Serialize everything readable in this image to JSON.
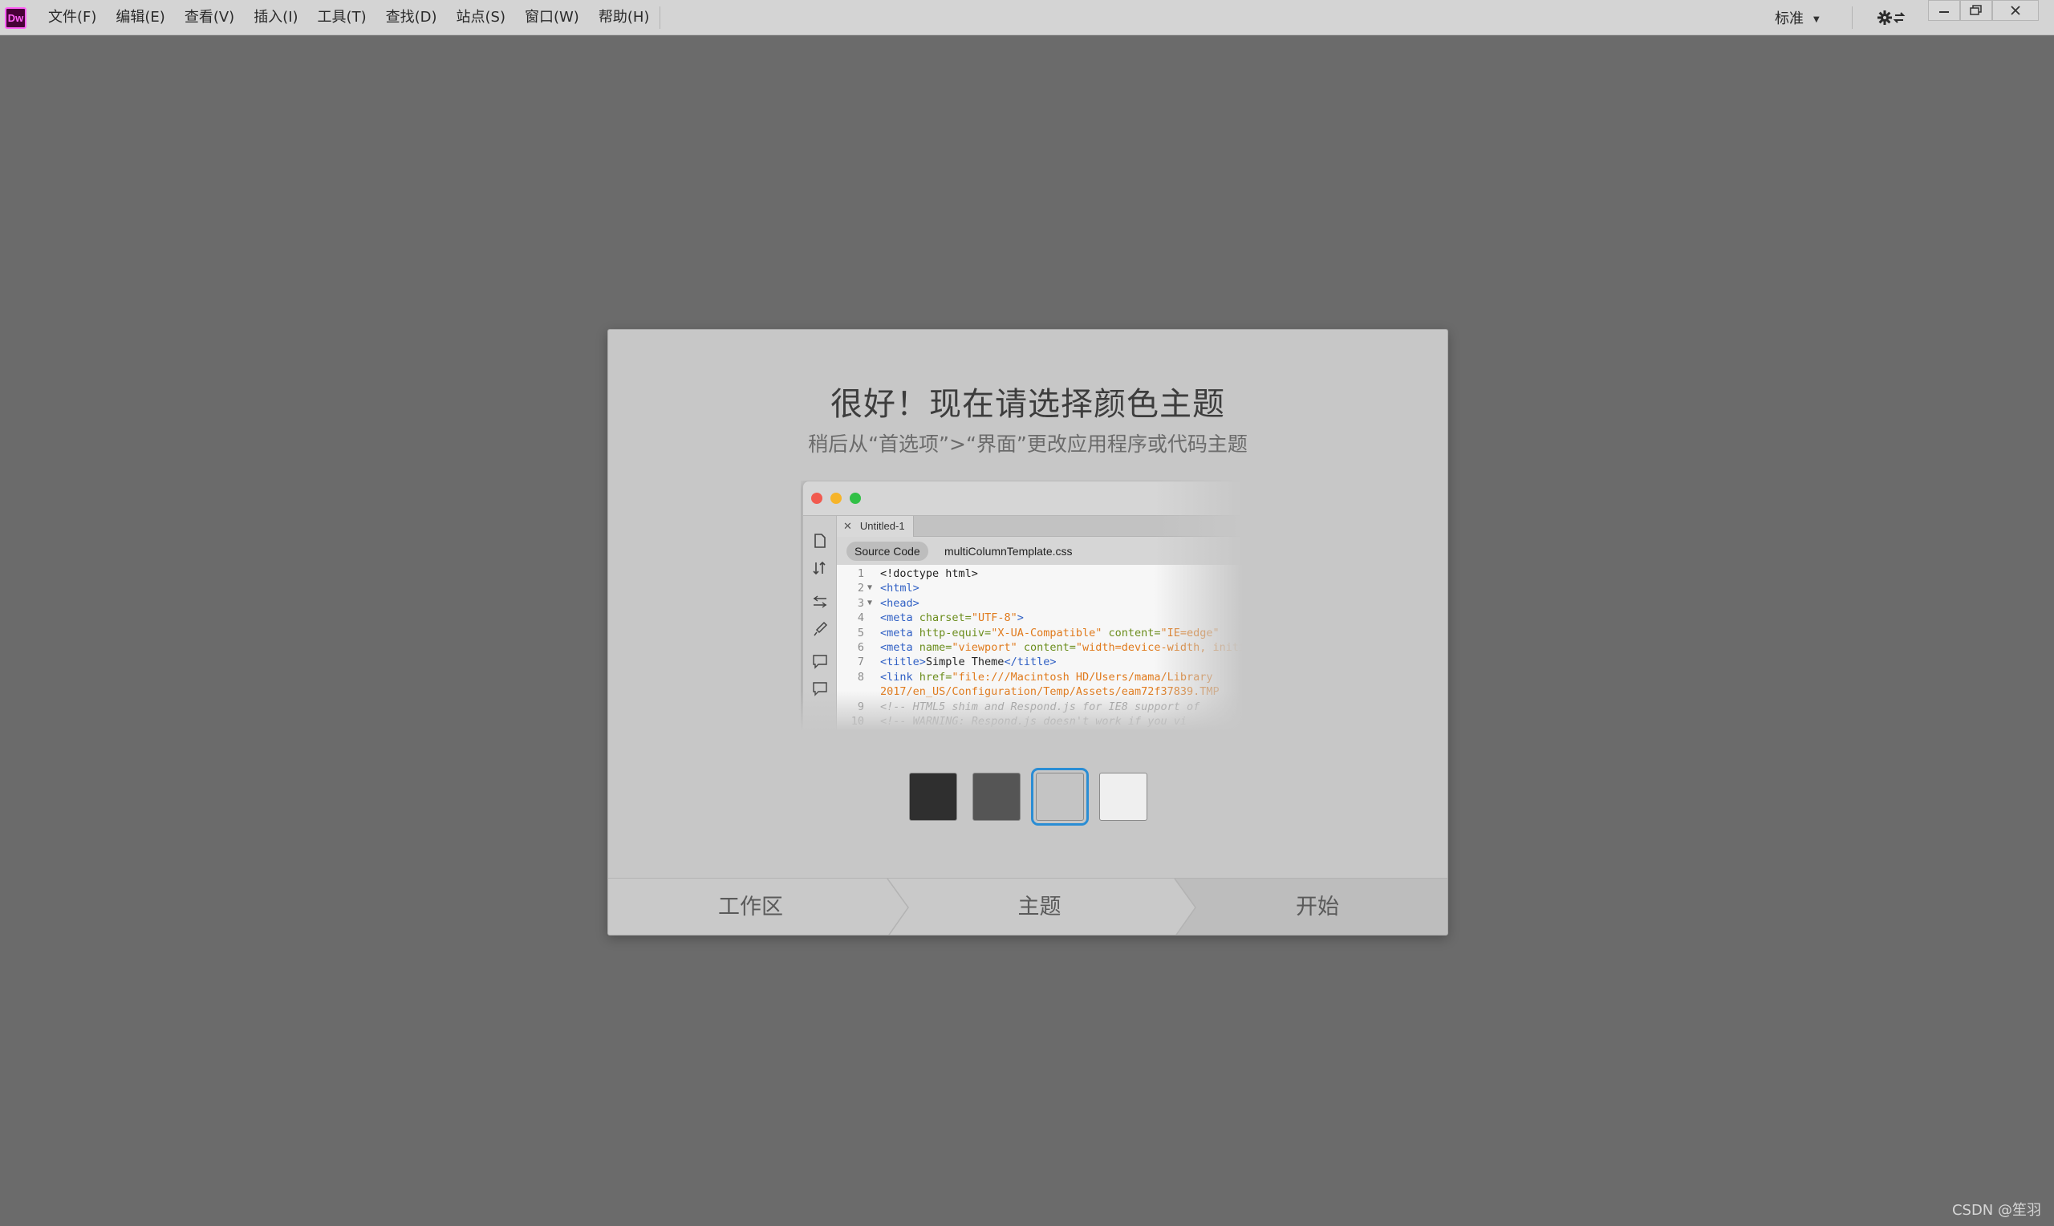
{
  "app": {
    "logo_text": "Dw",
    "logo_color": "#ff61f6",
    "logo_bg": "#470137"
  },
  "menu": {
    "items": [
      "文件(F)",
      "编辑(E)",
      "查看(V)",
      "插入(I)",
      "工具(T)",
      "查找(D)",
      "站点(S)",
      "窗口(W)",
      "帮助(H)"
    ]
  },
  "toolbar": {
    "workspace_label": "标准",
    "icons": [
      "chevron-down-icon",
      "gear-sync-icon",
      "minimize-icon",
      "restore-icon",
      "close-icon"
    ]
  },
  "dialog": {
    "title": "很好！现在请选择颜色主题",
    "subtitle": "稍后从“首选项”>“界面”更改应用程序或代码主题",
    "preview": {
      "tab_label": "Untitled-1",
      "active_doc": "Source Code",
      "other_doc": "multiColumnTemplate.css",
      "code_lines": [
        {
          "n": "1",
          "fold": "",
          "html": "<span class='txt'>&lt;!doctype html&gt;</span>"
        },
        {
          "n": "2",
          "fold": "▼",
          "html": "<span class='tg'>&lt;html&gt;</span>"
        },
        {
          "n": "3",
          "fold": "▼",
          "html": "<span class='tg'>&lt;head&gt;</span>"
        },
        {
          "n": "4",
          "fold": "",
          "html": "<span class='tg'>&lt;meta </span><span class='at'>charset=</span><span class='st'>\"UTF-8\"</span><span class='tg'>&gt;</span>"
        },
        {
          "n": "5",
          "fold": "",
          "html": "<span class='tg'>&lt;meta </span><span class='at'>http-equiv=</span><span class='st'>\"X-UA-Compatible\"</span><span class='at'> content=</span><span class='st'>\"IE=edge\"</span>"
        },
        {
          "n": "6",
          "fold": "",
          "html": "<span class='tg'>&lt;meta </span><span class='at'>name=</span><span class='st'>\"viewport\"</span><span class='at'> content=</span><span class='st'>\"width=device-width, initial</span>"
        },
        {
          "n": "7",
          "fold": "",
          "html": "<span class='tg'>&lt;title&gt;</span><span class='txt'>Simple Theme</span><span class='tg'>&lt;/title&gt;</span>"
        },
        {
          "n": "8",
          "fold": "",
          "html": "<span class='tg'>&lt;link </span><span class='at'>href=</span><span class='st'>\"file:///Macintosh HD/Users/mama/Library</span>"
        },
        {
          "n": "",
          "fold": "",
          "html": "<span class='st'>2017/en_US/Configuration/Temp/Assets/eam72f37839.TMP</span>"
        },
        {
          "n": "9",
          "fold": "",
          "html": "<span class='cm'>&lt;!-- HTML5 shim and Respond.js for IE8 support of</span>"
        },
        {
          "n": "10",
          "fold": "",
          "html": "<span class='cm'>&lt;!-- WARNING: Respond.js doesn't work if you vi</span>"
        }
      ]
    },
    "swatches": [
      {
        "name": "darkest",
        "color": "#2f2f2f",
        "selected": false
      },
      {
        "name": "dark",
        "color": "#555555",
        "selected": false
      },
      {
        "name": "light",
        "color": "#c4c4c4",
        "selected": true
      },
      {
        "name": "lightest",
        "color": "#efefef",
        "selected": false
      }
    ],
    "steps": [
      {
        "label": "工作区",
        "active": false
      },
      {
        "label": "主题",
        "active": false
      },
      {
        "label": "开始",
        "active": true
      }
    ]
  },
  "watermark": "CSDN @笙羽",
  "colors": {
    "background": "#6b6b6b",
    "menubar": "#d4d4d4",
    "dialog": "#c7c7c7",
    "selection_accent": "#2a8dd4"
  }
}
